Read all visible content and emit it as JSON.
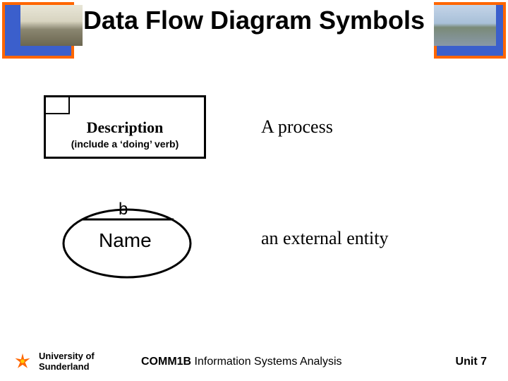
{
  "title": "Data Flow Diagram Symbols",
  "process": {
    "desc": "Description",
    "sub": "(include a ‘doing’ verb)",
    "label": "A process"
  },
  "entity": {
    "tag": "b",
    "name": "Name",
    "label": "an external entity"
  },
  "footer": {
    "uni_line1": "University of",
    "uni_line2": "Sunderland",
    "course_bold": "COMM1B",
    "course_rest": " Information Systems Analysis",
    "unit": "Unit 7"
  }
}
